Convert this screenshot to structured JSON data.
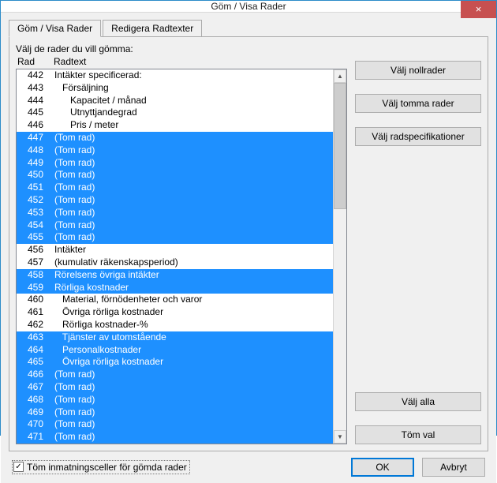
{
  "window": {
    "title": "Göm / Visa Rader",
    "close_label": "×"
  },
  "tabs": {
    "t0": "Göm / Visa Rader",
    "t1": "Redigera Radtexter"
  },
  "panel": {
    "prompt": "Välj de rader du vill gömma:",
    "col_rad": "Rad",
    "col_text": "Radtext"
  },
  "rows": [
    {
      "rad": "442",
      "txt": "Intäkter specificerad:",
      "indent": 0,
      "sel": false
    },
    {
      "rad": "443",
      "txt": "Försäljning",
      "indent": 1,
      "sel": false
    },
    {
      "rad": "444",
      "txt": "Kapacitet / månad",
      "indent": 2,
      "sel": false
    },
    {
      "rad": "445",
      "txt": "Utnyttjandegrad",
      "indent": 2,
      "sel": false
    },
    {
      "rad": "446",
      "txt": "Pris / meter",
      "indent": 2,
      "sel": false
    },
    {
      "rad": "447",
      "txt": "(Tom rad)",
      "indent": 0,
      "sel": true
    },
    {
      "rad": "448",
      "txt": "(Tom rad)",
      "indent": 0,
      "sel": true
    },
    {
      "rad": "449",
      "txt": "(Tom rad)",
      "indent": 0,
      "sel": true
    },
    {
      "rad": "450",
      "txt": "(Tom rad)",
      "indent": 0,
      "sel": true
    },
    {
      "rad": "451",
      "txt": "(Tom rad)",
      "indent": 0,
      "sel": true
    },
    {
      "rad": "452",
      "txt": "(Tom rad)",
      "indent": 0,
      "sel": true
    },
    {
      "rad": "453",
      "txt": "(Tom rad)",
      "indent": 0,
      "sel": true
    },
    {
      "rad": "454",
      "txt": "(Tom rad)",
      "indent": 0,
      "sel": true
    },
    {
      "rad": "455",
      "txt": "(Tom rad)",
      "indent": 0,
      "sel": true
    },
    {
      "rad": "456",
      "txt": "Intäkter",
      "indent": 0,
      "sel": false
    },
    {
      "rad": "457",
      "txt": "(kumulativ räkenskapsperiod)",
      "indent": 0,
      "sel": false
    },
    {
      "rad": "458",
      "txt": "Rörelsens övriga intäkter",
      "indent": 0,
      "sel": true
    },
    {
      "rad": "459",
      "txt": "Rörliga kostnader",
      "indent": 0,
      "sel": true
    },
    {
      "rad": "460",
      "txt": "Material, förnödenheter och varor",
      "indent": 1,
      "sel": false
    },
    {
      "rad": "461",
      "txt": "Övriga rörliga kostnader",
      "indent": 1,
      "sel": false
    },
    {
      "rad": "462",
      "txt": "Rörliga kostnader-%",
      "indent": 1,
      "sel": false
    },
    {
      "rad": "463",
      "txt": "Tjänster av utomstående",
      "indent": 1,
      "sel": true
    },
    {
      "rad": "464",
      "txt": "Personalkostnader",
      "indent": 1,
      "sel": true
    },
    {
      "rad": "465",
      "txt": "Övriga rörliga kostnader",
      "indent": 1,
      "sel": true
    },
    {
      "rad": "466",
      "txt": "(Tom rad)",
      "indent": 0,
      "sel": true
    },
    {
      "rad": "467",
      "txt": "(Tom rad)",
      "indent": 0,
      "sel": true
    },
    {
      "rad": "468",
      "txt": "(Tom rad)",
      "indent": 0,
      "sel": true
    },
    {
      "rad": "469",
      "txt": "(Tom rad)",
      "indent": 0,
      "sel": true
    },
    {
      "rad": "470",
      "txt": "(Tom rad)",
      "indent": 0,
      "sel": true
    },
    {
      "rad": "471",
      "txt": "(Tom rad)",
      "indent": 0,
      "sel": true
    }
  ],
  "buttons": {
    "null_rows": "Välj nollrader",
    "empty_rows": "Välj tomma rader",
    "row_specs": "Välj radspecifikationer",
    "select_all": "Välj alla",
    "clear_sel": "Töm val"
  },
  "footer": {
    "checkbox_label": "Töm inmatningsceller för gömda rader",
    "checkbox_checked": "✓",
    "ok": "OK",
    "cancel": "Avbryt"
  }
}
